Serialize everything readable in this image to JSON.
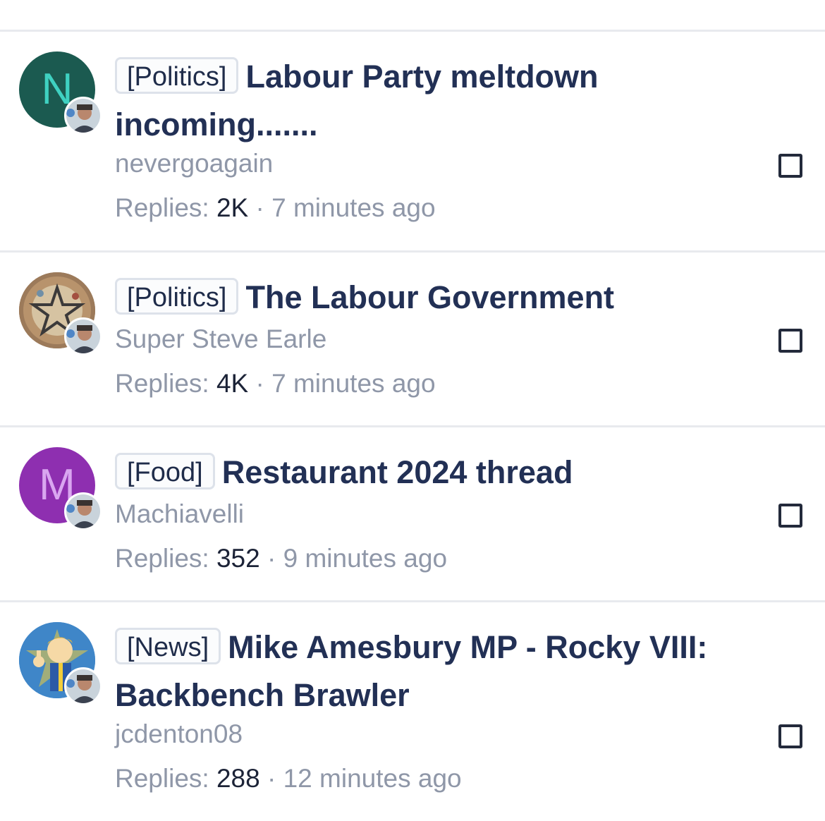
{
  "threads": [
    {
      "prefix": "[Politics]",
      "title": "Labour Party meltdown incoming.......",
      "author": "nevergoagain",
      "replies_label": "Replies:",
      "replies": "2K",
      "time": "7 minutes ago",
      "avatar": {
        "type": "letter",
        "letter": "N",
        "bg": "#1b5a50",
        "fg": "#3fd1c1"
      }
    },
    {
      "prefix": "[Politics]",
      "title": "The Labour Government",
      "author": "Super Steve Earle",
      "replies_label": "Replies:",
      "replies": "4K",
      "time": "7 minutes ago",
      "avatar": {
        "type": "image",
        "icon": "star-mosaic-avatar"
      }
    },
    {
      "prefix": "[Food]",
      "title": "Restaurant 2024 thread",
      "author": "Machiavelli",
      "replies_label": "Replies:",
      "replies": "352",
      "time": "9 minutes ago",
      "avatar": {
        "type": "letter",
        "letter": "M",
        "bg": "#8e2fb0",
        "fg": "#d9a6f0"
      }
    },
    {
      "prefix": "[News]",
      "title": "Mike Amesbury MP - Rocky VIII: Backbench Brawler",
      "author": "jcdenton08",
      "replies_label": "Replies:",
      "replies": "288",
      "time": "12 minutes ago",
      "avatar": {
        "type": "image",
        "icon": "vault-boy-avatar"
      }
    }
  ],
  "separator": "·",
  "colors": {
    "title": "#223055",
    "muted": "#8f97a8",
    "divider": "#e8eaee"
  }
}
